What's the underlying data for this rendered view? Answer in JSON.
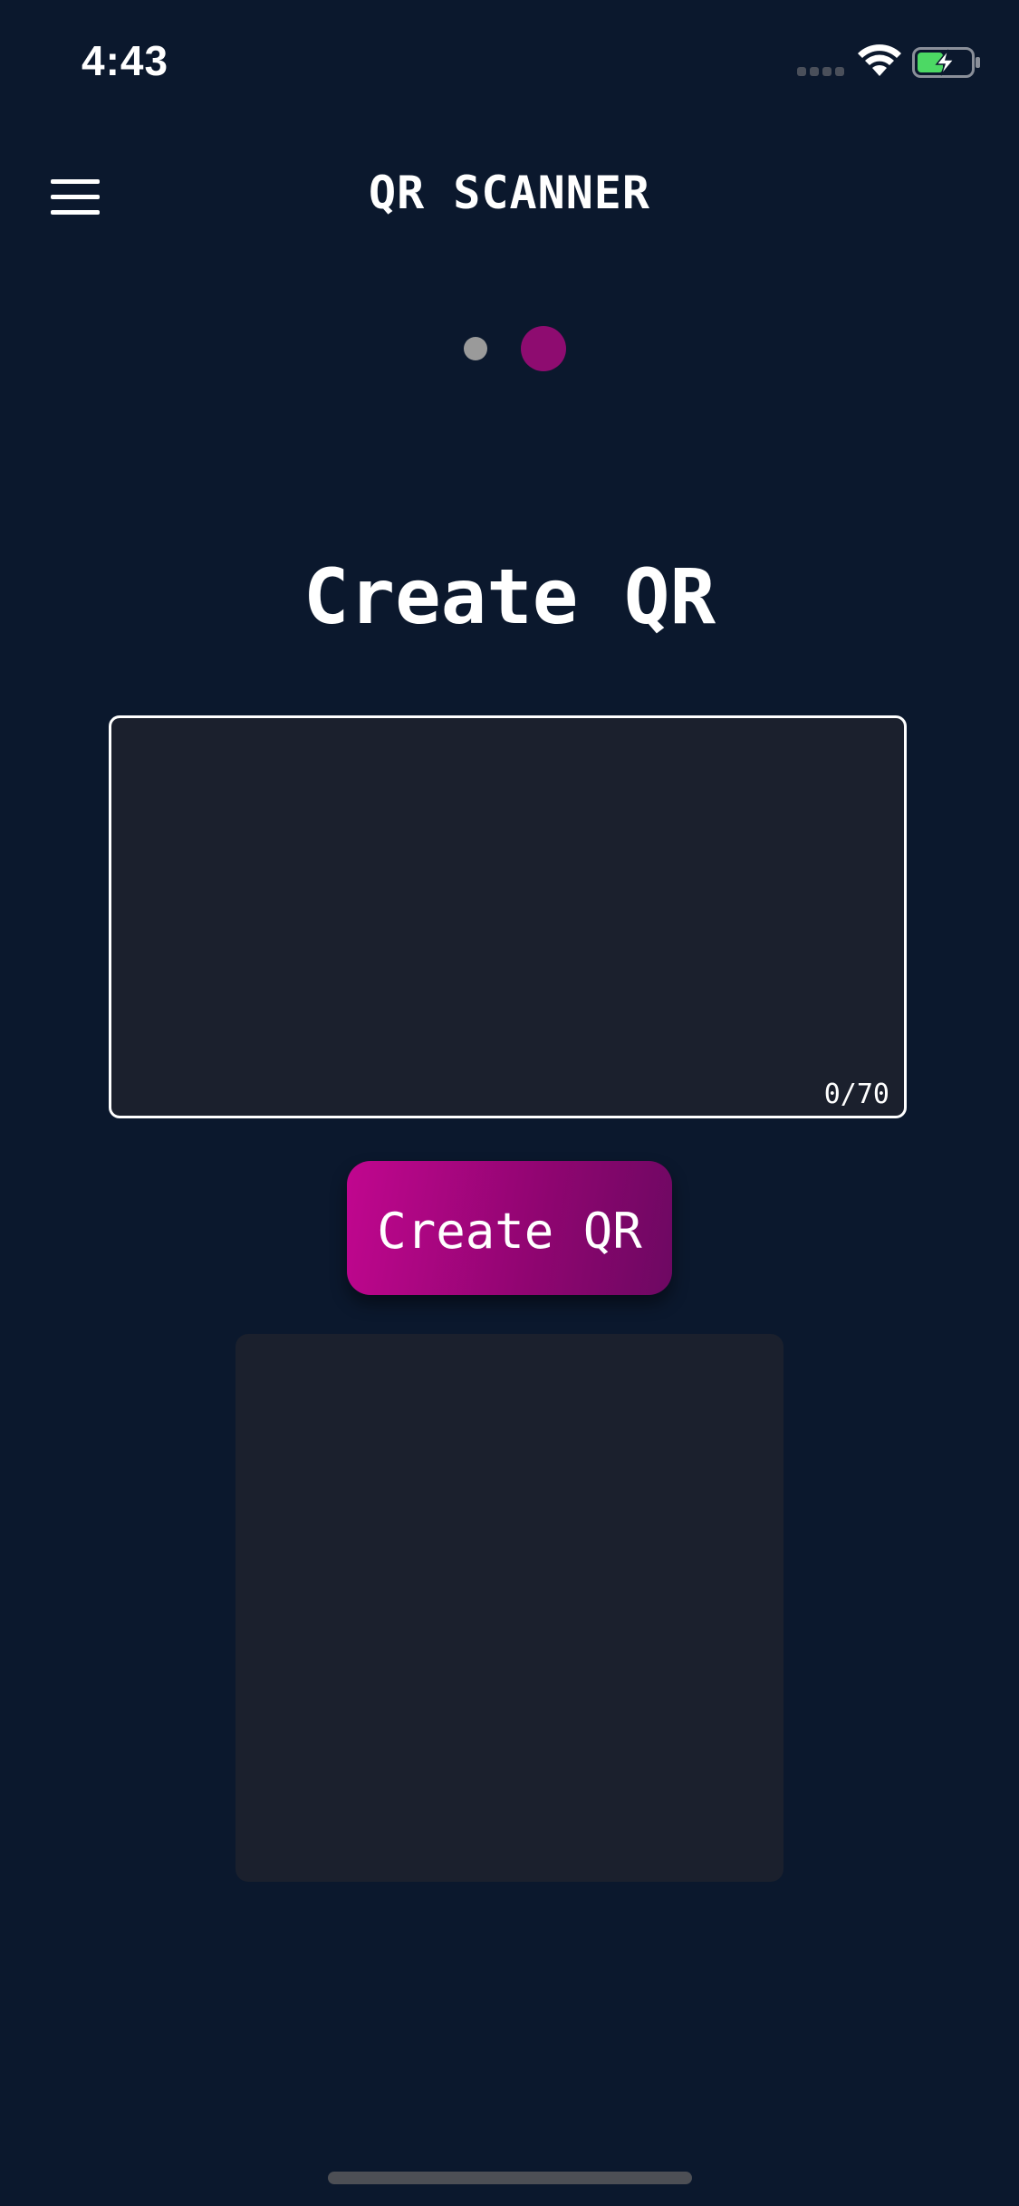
{
  "status_bar": {
    "time": "4:43",
    "signal_icon": "cellular-signal-icon",
    "wifi_icon": "wifi-icon",
    "battery_icon": "battery-charging-icon",
    "battery_color": "#4cd964"
  },
  "header": {
    "menu_icon": "hamburger-menu-icon",
    "title": "QR SCANNER"
  },
  "pager": {
    "page_count": 2,
    "active_index": 1,
    "active_color": "#8e0c70",
    "inactive_color": "#9a9a9a"
  },
  "main": {
    "title": "Create QR",
    "input": {
      "value": "",
      "placeholder": "",
      "counter": "0/70"
    },
    "create_button_label": "Create QR"
  },
  "colors": {
    "background": "#0b182d",
    "panel": "#1b202d",
    "accent": "#c1068f"
  }
}
